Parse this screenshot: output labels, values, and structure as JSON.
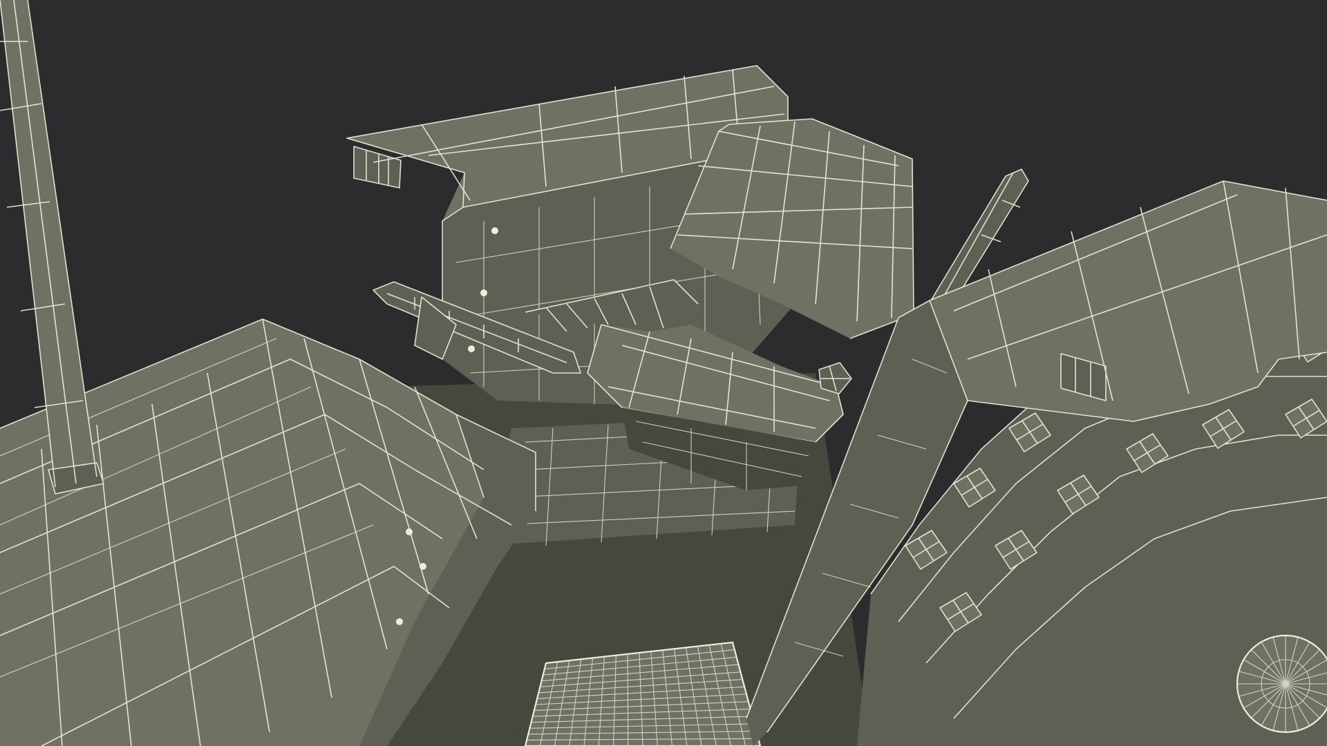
{
  "scene": {
    "subject": "tractor-wireframe-render",
    "colors": {
      "background": "#2b2c2e",
      "surface": "#6f7262",
      "surface_shade": "#5d6052",
      "surface_dark": "#45483d",
      "wire": "#efeede"
    }
  },
  "parts": [
    "exhaust-pipe",
    "engine-hood",
    "steering-wheel",
    "left-fender",
    "right-fender",
    "driver-seat",
    "gear-lever",
    "rear-wheel-tire",
    "floor-step-plate",
    "chassis-frame"
  ]
}
